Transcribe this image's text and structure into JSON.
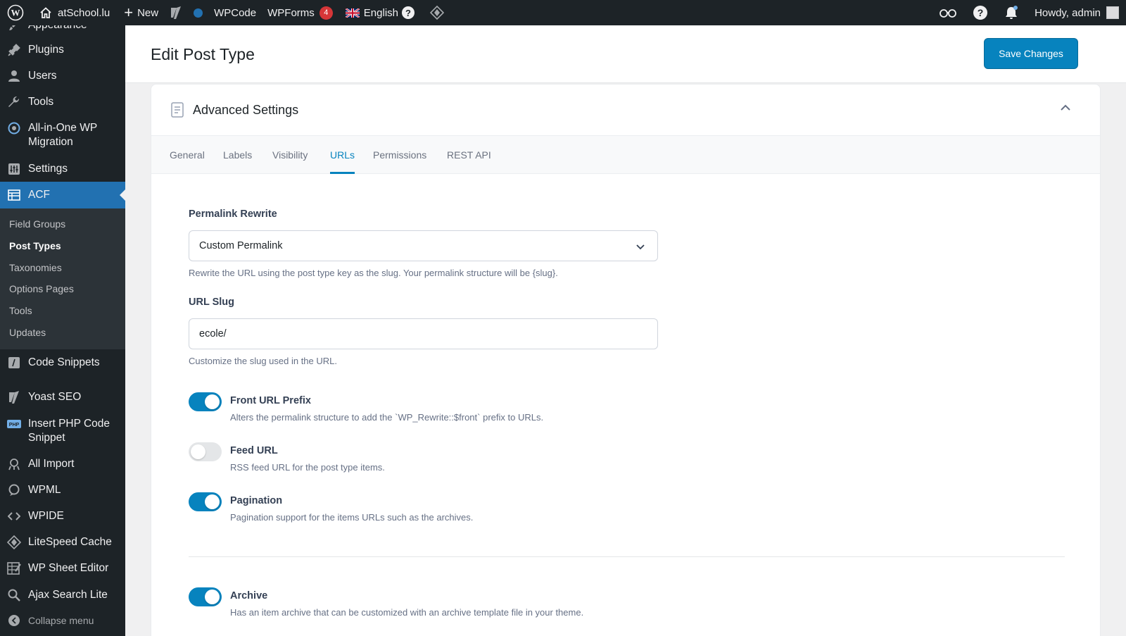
{
  "adminbar": {
    "site_name": "atSchool.lu",
    "new_label": "New",
    "wpcode_label": "WPCode",
    "wpforms_label": "WPForms",
    "wpforms_count": "4",
    "language_label": "English",
    "howdy_label": "Howdy, admin"
  },
  "sidebar": {
    "items": [
      {
        "label": "Appearance",
        "icon": "paintbrush-icon"
      },
      {
        "label": "Plugins",
        "icon": "plugin-icon"
      },
      {
        "label": "Users",
        "icon": "user-icon"
      },
      {
        "label": "Tools",
        "icon": "wrench-icon"
      },
      {
        "label": "All-in-One WP Migration",
        "icon": "migration-icon"
      },
      {
        "label": "Settings",
        "icon": "settings-icon"
      },
      {
        "label": "ACF",
        "icon": "acf-icon"
      },
      {
        "label": "Code Snippets",
        "icon": "code-snippets-icon"
      },
      {
        "label": "Yoast SEO",
        "icon": "yoast-icon"
      },
      {
        "label": "Insert PHP Code Snippet",
        "icon": "php-icon"
      },
      {
        "label": "All Import",
        "icon": "import-icon"
      },
      {
        "label": "WPML",
        "icon": "wpml-icon"
      },
      {
        "label": "WPIDE",
        "icon": "code-icon"
      },
      {
        "label": "LiteSpeed Cache",
        "icon": "litespeed-icon"
      },
      {
        "label": "WP Sheet Editor",
        "icon": "sheet-icon"
      },
      {
        "label": "Ajax Search Lite",
        "icon": "search-icon"
      },
      {
        "label": "Collapse menu",
        "icon": "collapse-icon"
      }
    ],
    "acf_submenu": [
      "Field Groups",
      "Post Types",
      "Taxonomies",
      "Options Pages",
      "Tools",
      "Updates"
    ]
  },
  "header": {
    "title": "Edit Post Type",
    "save_label": "Save Changes"
  },
  "card": {
    "title": "Advanced Settings",
    "tabs": [
      "General",
      "Labels",
      "Visibility",
      "URLs",
      "Permissions",
      "REST API"
    ],
    "active_tab": "URLs"
  },
  "fields": {
    "permalink_label": "Permalink Rewrite",
    "permalink_value": "Custom Permalink",
    "permalink_help": "Rewrite the URL using the post type key as the slug. Your permalink structure will be {slug}.",
    "slug_label": "URL Slug",
    "slug_value": "ecole/",
    "slug_help": "Customize the slug used in the URL."
  },
  "toggles": [
    {
      "title": "Front URL Prefix",
      "desc": "Alters the permalink structure to add the `WP_Rewrite::$front` prefix to URLs.",
      "on": true
    },
    {
      "title": "Feed URL",
      "desc": "RSS feed URL for the post type items.",
      "on": false
    },
    {
      "title": "Pagination",
      "desc": "Pagination support for the items URLs such as the archives.",
      "on": true
    },
    {
      "title": "Archive",
      "desc": "Has an item archive that can be customized with an archive template file in your theme.",
      "on": true
    }
  ],
  "colors": {
    "accent": "#0783be",
    "admin_bar": "#1d2327",
    "menu_current": "#2271b1"
  }
}
